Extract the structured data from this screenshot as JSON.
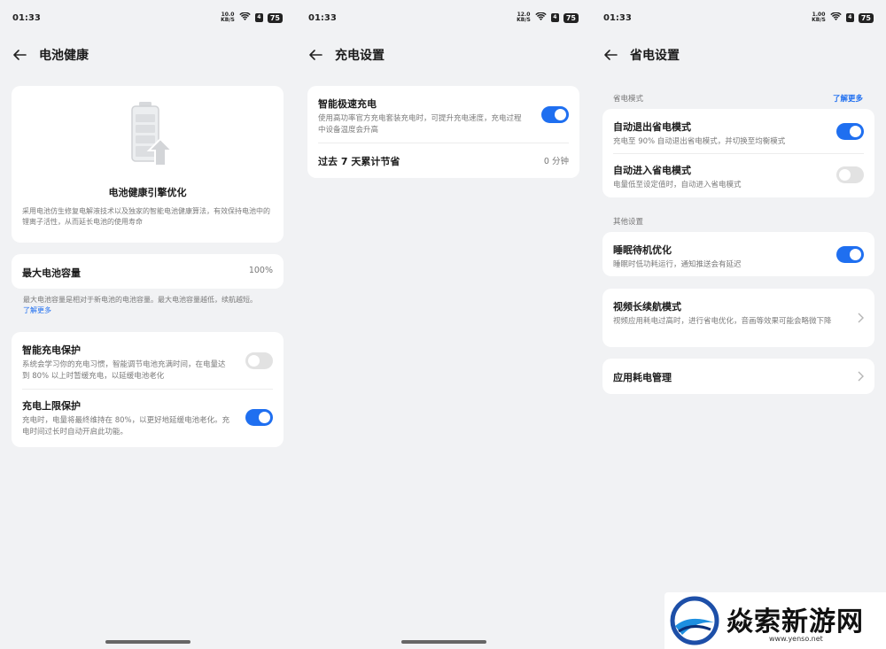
{
  "status": {
    "time": "01:33",
    "battery": "75",
    "sim": "4"
  },
  "screen1": {
    "speed": "10.0\nKB/S",
    "title": "电池健康",
    "hero": {
      "title": "电池健康引擎优化",
      "desc": "采用电池仿生修复电解液技术以及独家的智能电池健康算法，有效保持电池中的锂离子活性，从而延长电池的使用寿命"
    },
    "capacity": {
      "label": "最大电池容量",
      "value": "100%"
    },
    "capacity_note": "最大电池容量是相对于新电池的电池容量。最大电池容量越低，续航越短。",
    "learn_more": "了解更多",
    "smart_charge": {
      "title": "智能充电保护",
      "desc": "系统会学习你的充电习惯，智能调节电池充满时间，在电量达到 80% 以上时暂缓充电，以延缓电池老化",
      "enabled": false
    },
    "charge_limit": {
      "title": "充电上限保护",
      "desc": "充电时，电量将最终维持在 80%，以更好地延缓电池老化。充电时间过长时自动开启此功能。",
      "enabled": true
    }
  },
  "screen2": {
    "speed": "12.0\nKB/S",
    "title": "充电设置",
    "fast_charge": {
      "title": "智能极速充电",
      "desc": "使用高功率官方充电套装充电时，可提升充电速度，充电过程中设备温度会升高",
      "enabled": true
    },
    "saved": {
      "label": "过去 7 天累计节省",
      "value": "0 分钟"
    }
  },
  "screen3": {
    "speed": "1.00\nKB/S",
    "title": "省电设置",
    "section1": {
      "label": "省电模式",
      "link": "了解更多"
    },
    "auto_exit": {
      "title": "自动退出省电模式",
      "desc": "充电至 90% 自动退出省电模式，并切换至均衡模式",
      "enabled": true
    },
    "auto_enter": {
      "title": "自动进入省电模式",
      "desc": "电量低至设定值时，自动进入省电模式",
      "enabled": false
    },
    "section2": {
      "label": "其他设置"
    },
    "sleep": {
      "title": "睡眠待机优化",
      "desc": "睡眠时低功耗运行，通知推送会有延迟",
      "enabled": true
    },
    "video": {
      "title": "视频长续航模式",
      "desc": "视频应用耗电过高时，进行省电优化，音画等效果可能会略微下降"
    },
    "app_power": {
      "title": "应用耗电管理"
    }
  },
  "watermark": {
    "text": "焱索新游网",
    "url": "www.yenso.net"
  }
}
